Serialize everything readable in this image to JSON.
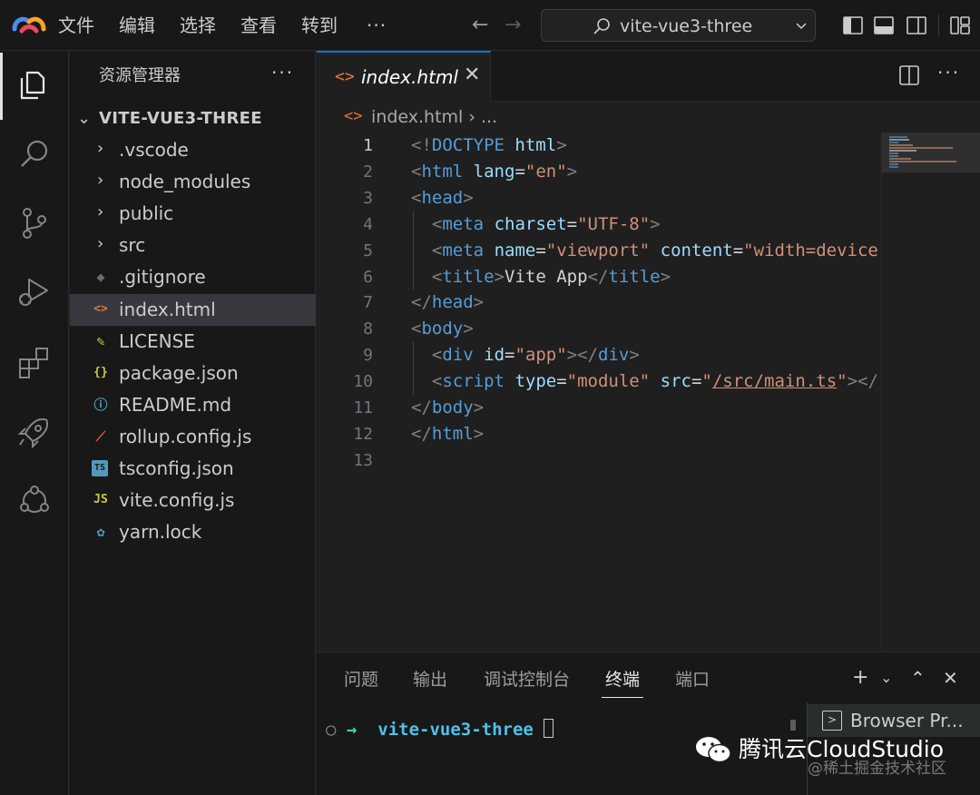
{
  "titlebar": {
    "menu": [
      "文件",
      "编辑",
      "选择",
      "查看",
      "转到",
      "···"
    ],
    "search_text": "vite-vue3-three"
  },
  "sidebar": {
    "title": "资源管理器",
    "more": "···",
    "folder_name": "VITE-VUE3-THREE",
    "items": [
      {
        "label": ".vscode",
        "kind": "folder"
      },
      {
        "label": "node_modules",
        "kind": "folder"
      },
      {
        "label": "public",
        "kind": "folder"
      },
      {
        "label": "src",
        "kind": "folder"
      },
      {
        "label": ".gitignore",
        "kind": "file",
        "icon": "git-icon",
        "icon_color": "#6d6d6d"
      },
      {
        "label": "index.html",
        "kind": "file",
        "icon": "html-icon",
        "icon_color": "#e37933",
        "selected": true
      },
      {
        "label": "LICENSE",
        "kind": "file",
        "icon": "license-icon",
        "icon_color": "#cbcb41"
      },
      {
        "label": "package.json",
        "kind": "file",
        "icon": "json-icon",
        "icon_color": "#cbcb41"
      },
      {
        "label": "README.md",
        "kind": "file",
        "icon": "info-icon",
        "icon_color": "#519aba"
      },
      {
        "label": "rollup.config.js",
        "kind": "file",
        "icon": "rollup-icon",
        "icon_color": "#e44d4d"
      },
      {
        "label": "tsconfig.json",
        "kind": "file",
        "icon": "typescript-icon",
        "icon_color": "#519aba"
      },
      {
        "label": "vite.config.js",
        "kind": "file",
        "icon": "javascript-icon",
        "icon_color": "#cbcb41"
      },
      {
        "label": "yarn.lock",
        "kind": "file",
        "icon": "yarn-icon",
        "icon_color": "#519aba"
      }
    ]
  },
  "editor": {
    "tab_label": "index.html",
    "breadcrumb": "index.html  ›  ...",
    "lines": [
      {
        "n": "1",
        "html": "<span class=\"t-tag\">&lt;!</span><span class=\"t-name\">DOCTYPE</span><span class=\"t-txt\"> </span><span class=\"t-attr\">html</span><span class=\"t-tag\">&gt;</span>"
      },
      {
        "n": "2",
        "html": "<span class=\"t-tag\">&lt;</span><span class=\"t-name\">html</span><span class=\"t-txt\"> </span><span class=\"t-attr\">lang</span><span class=\"t-txt\">=</span><span class=\"t-str\">\"en\"</span><span class=\"t-tag\">&gt;</span>"
      },
      {
        "n": "3",
        "html": "<span class=\"t-tag\">&lt;</span><span class=\"t-name\">head</span><span class=\"t-tag\">&gt;</span>"
      },
      {
        "n": "4",
        "html": "  <span class=\"t-tag\">&lt;</span><span class=\"t-name\">meta</span><span class=\"t-txt\"> </span><span class=\"t-attr\">charset</span><span class=\"t-txt\">=</span><span class=\"t-str\">\"UTF-8\"</span><span class=\"t-tag\">&gt;</span>"
      },
      {
        "n": "5",
        "html": "  <span class=\"t-tag\">&lt;</span><span class=\"t-name\">meta</span><span class=\"t-txt\"> </span><span class=\"t-attr\">name</span><span class=\"t-txt\">=</span><span class=\"t-str\">\"viewport\"</span><span class=\"t-txt\"> </span><span class=\"t-attr\">content</span><span class=\"t-txt\">=</span><span class=\"t-str\">\"width=device</span>"
      },
      {
        "n": "6",
        "html": "  <span class=\"t-tag\">&lt;</span><span class=\"t-name\">title</span><span class=\"t-tag\">&gt;</span><span class=\"t-txt\">Vite App</span><span class=\"t-tag\">&lt;/</span><span class=\"t-name\">title</span><span class=\"t-tag\">&gt;</span>"
      },
      {
        "n": "7",
        "html": "<span class=\"t-tag\">&lt;/</span><span class=\"t-name\">head</span><span class=\"t-tag\">&gt;</span>"
      },
      {
        "n": "8",
        "html": "<span class=\"t-tag\">&lt;</span><span class=\"t-name\">body</span><span class=\"t-tag\">&gt;</span>"
      },
      {
        "n": "9",
        "html": "  <span class=\"t-tag\">&lt;</span><span class=\"t-name\">div</span><span class=\"t-txt\"> </span><span class=\"t-attr\">id</span><span class=\"t-txt\">=</span><span class=\"t-str\">\"app\"</span><span class=\"t-tag\">&gt;&lt;/</span><span class=\"t-name\">div</span><span class=\"t-tag\">&gt;</span>"
      },
      {
        "n": "10",
        "html": "  <span class=\"t-tag\">&lt;</span><span class=\"t-name\">script</span><span class=\"t-txt\"> </span><span class=\"t-attr\">type</span><span class=\"t-txt\">=</span><span class=\"t-str\">\"module\"</span><span class=\"t-txt\"> </span><span class=\"t-attr\">src</span><span class=\"t-txt\">=</span><span class=\"t-str\">\"</span><span class=\"t-link\">/src/main.ts</span><span class=\"t-str\">\"</span><span class=\"t-tag\">&gt;&lt;/</span>"
      },
      {
        "n": "11",
        "html": "<span class=\"t-tag\">&lt;/</span><span class=\"t-name\">body</span><span class=\"t-tag\">&gt;</span>"
      },
      {
        "n": "12",
        "html": "<span class=\"t-tag\">&lt;/</span><span class=\"t-name\">html</span><span class=\"t-tag\">&gt;</span>"
      },
      {
        "n": "13",
        "html": ""
      }
    ],
    "current_line": "1"
  },
  "panel": {
    "tabs": [
      "问题",
      "输出",
      "调试控制台",
      "终端",
      "端口"
    ],
    "active_tab": "终端",
    "terminal_dir": "vite-vue3-three",
    "terminal_list_item": "Browser Pr..."
  },
  "watermark": {
    "text": "腾讯云CloudStudio",
    "sub": "@稀土掘金技术社区"
  },
  "colors": {
    "accent": "#0078d4",
    "sidebar_selected": "#37373d",
    "html_icon": "#e37933"
  }
}
